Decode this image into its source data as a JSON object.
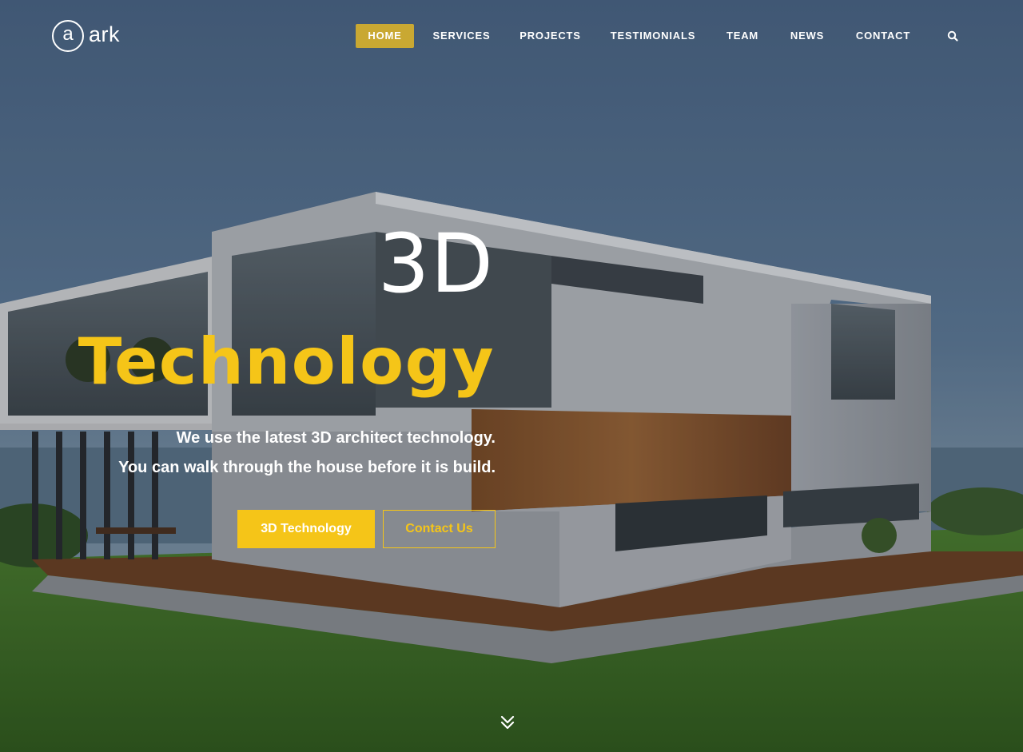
{
  "logo": {
    "mark": "a",
    "text": "ark"
  },
  "nav": {
    "items": [
      {
        "label": "HOME",
        "active": true
      },
      {
        "label": "SERVICES",
        "active": false
      },
      {
        "label": "PROJECTS",
        "active": false
      },
      {
        "label": "TESTIMONIALS",
        "active": false
      },
      {
        "label": "TEAM",
        "active": false
      },
      {
        "label": "NEWS",
        "active": false
      },
      {
        "label": "CONTACT",
        "active": false
      }
    ],
    "search_icon": "search-icon"
  },
  "hero": {
    "line1": "3D",
    "line2": "Technology",
    "desc_line1": "We use the latest 3D architect technology.",
    "desc_line2": "You can walk through the house before it is build.",
    "primary_button": "3D Technology",
    "secondary_button": "Contact Us",
    "scroll_icon": "double-chevron-down-icon"
  },
  "colors": {
    "accent": "#f5c518",
    "nav_active_bg": "#c9a832",
    "text": "#ffffff"
  }
}
